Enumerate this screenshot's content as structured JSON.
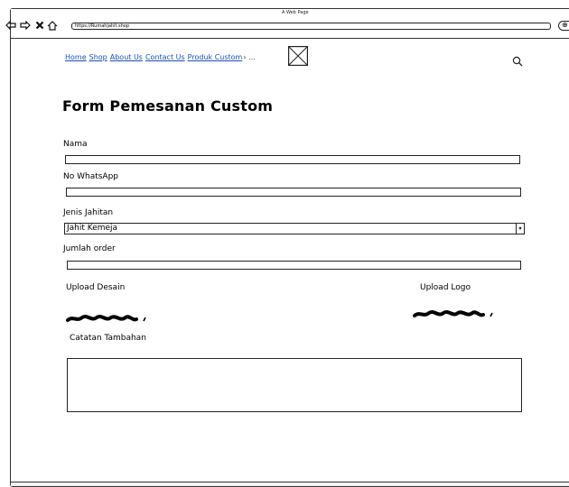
{
  "window": {
    "title": "A Web Page",
    "url": "https://Rumahjahit.shop"
  },
  "nav": {
    "links": [
      "Home",
      "Shop",
      "About Us",
      "Contact Us",
      "Produk Custom"
    ],
    "more": "› ..."
  },
  "form": {
    "title": "Form Pemesanan Custom",
    "nama_label": "Nama",
    "whatsapp_label": "No WhatsApp",
    "jenis_label": "Jenis Jahitan",
    "jenis_value": "Jahit Kemeja",
    "jumlah_label": "Jumlah order",
    "upload_desain_label": "Upload Desain",
    "upload_logo_label": "Upload Logo",
    "catatan_label": "Catatan Tambahan"
  },
  "icons": {
    "back": "back-arrow-icon",
    "forward": "forward-arrow-icon",
    "stop": "close-icon",
    "home": "home-icon",
    "search": "search-icon",
    "logo": "image-placeholder-icon"
  }
}
